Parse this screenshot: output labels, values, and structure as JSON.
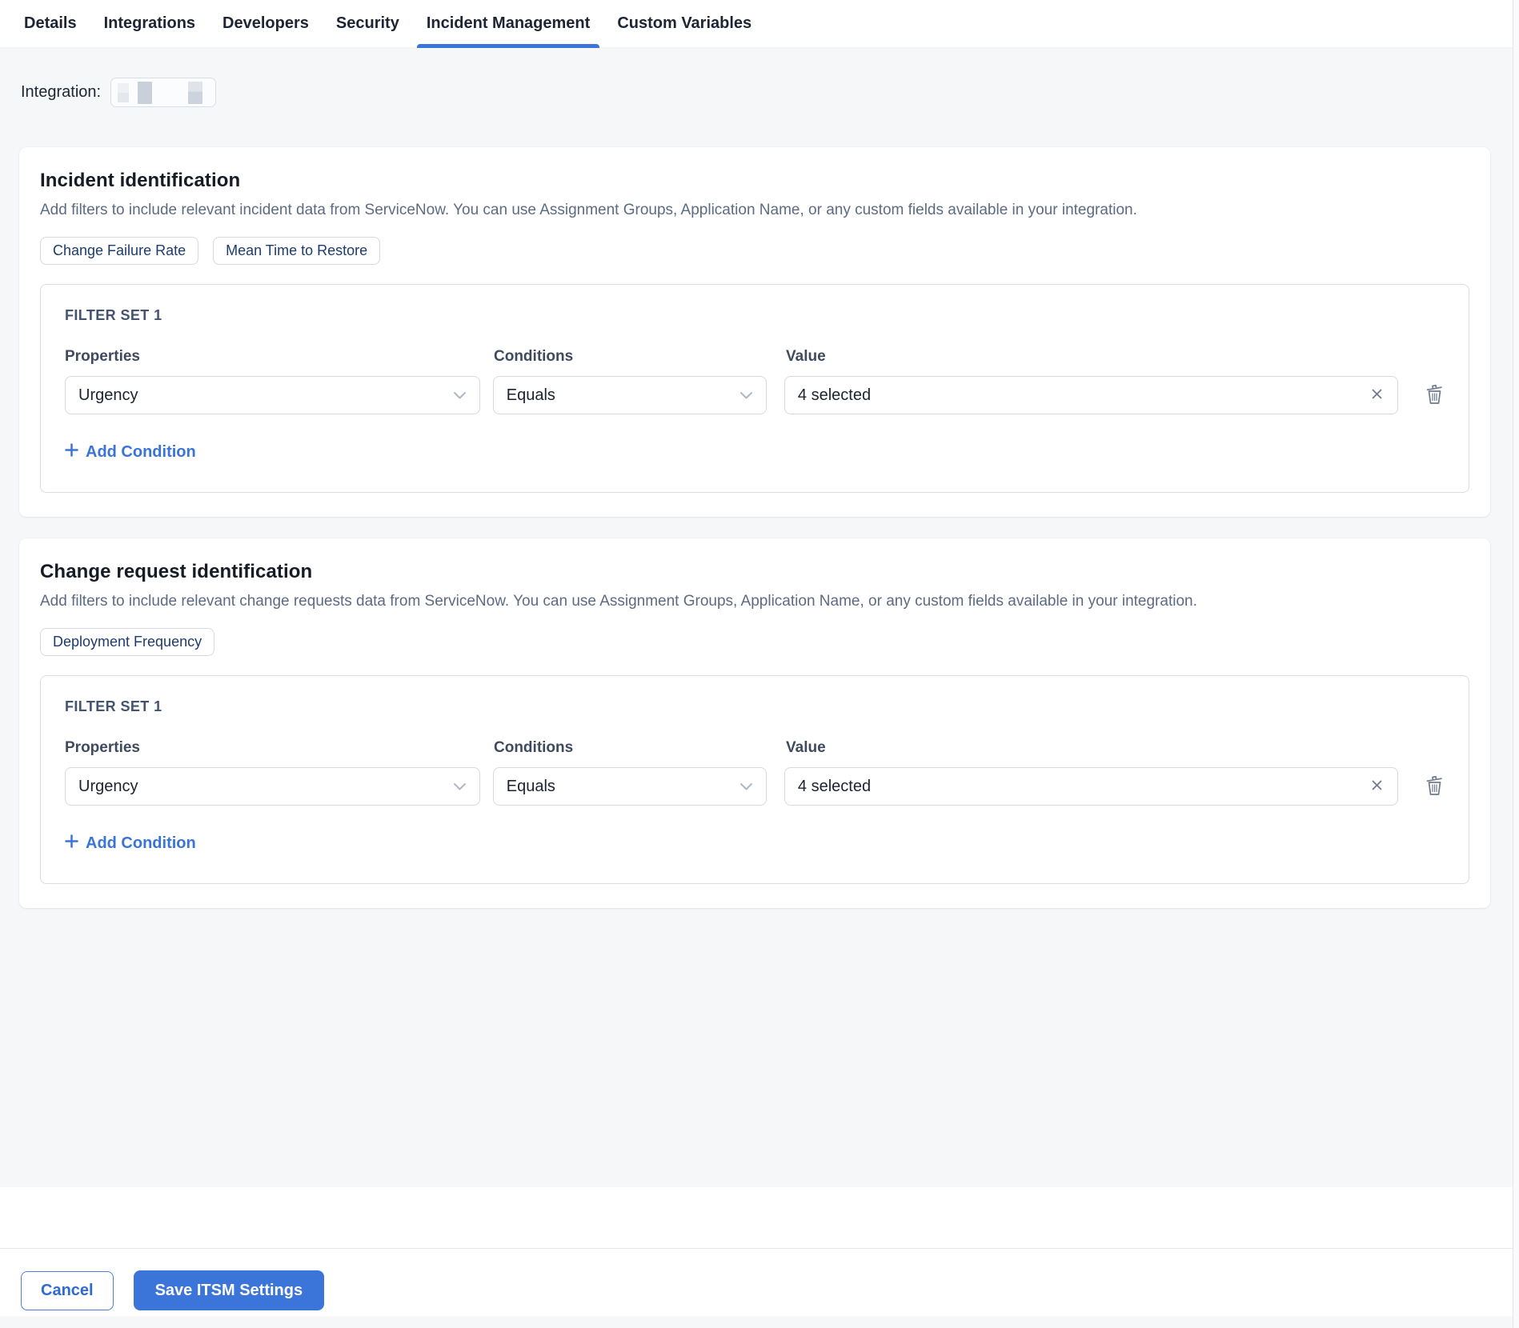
{
  "colors": {
    "accent_blue": "#3B75D9",
    "chip_text_navy": "#1D3C6D",
    "page_background": "#F6F7F9",
    "field_border": "#D6D9DF",
    "muted_text": "#5D6B82"
  },
  "tabs": {
    "active_index": 4,
    "items": [
      {
        "label": "Details"
      },
      {
        "label": "Integrations"
      },
      {
        "label": "Developers"
      },
      {
        "label": "Security"
      },
      {
        "label": "Incident Management"
      },
      {
        "label": "Custom Variables"
      }
    ]
  },
  "integration": {
    "label": "Integration:",
    "value_redacted": true
  },
  "cards": [
    {
      "title": "Incident identification",
      "description": "Add filters to include relevant incident data from ServiceNow. You can use Assignment Groups, Application Name, or any custom fields available in your integration.",
      "chips": [
        "Change Failure Rate",
        "Mean Time to Restore"
      ],
      "filter_set": {
        "title": "FILTER SET 1",
        "columns": {
          "properties": "Properties",
          "conditions": "Conditions",
          "value": "Value"
        },
        "row": {
          "property": "Urgency",
          "condition": "Equals",
          "value": "4 selected"
        },
        "add_condition_label": "Add Condition"
      }
    },
    {
      "title": "Change request identification",
      "description": "Add filters to include relevant change requests data from ServiceNow. You can use Assignment Groups, Application Name, or any custom fields available in your integration.",
      "chips": [
        "Deployment Frequency"
      ],
      "filter_set": {
        "title": "FILTER SET 1",
        "columns": {
          "properties": "Properties",
          "conditions": "Conditions",
          "value": "Value"
        },
        "row": {
          "property": "Urgency",
          "condition": "Equals",
          "value": "4 selected"
        },
        "add_condition_label": "Add Condition"
      }
    }
  ],
  "footer": {
    "cancel_label": "Cancel",
    "save_label": "Save ITSM Settings"
  }
}
